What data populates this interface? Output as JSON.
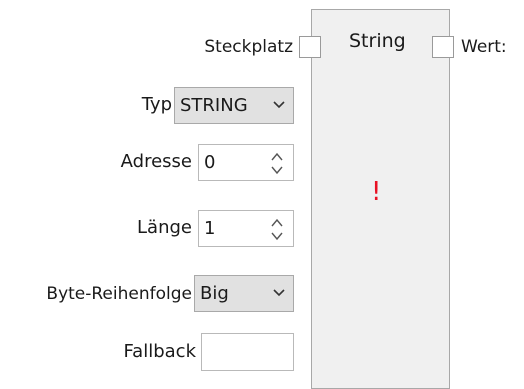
{
  "node": {
    "title": "String",
    "warning": "!",
    "input_port_label": "Steckplatz",
    "output_port_label": "Wert:"
  },
  "properties": {
    "type": {
      "label": "Typ",
      "value": "STRING"
    },
    "address": {
      "label": "Adresse",
      "value": "0"
    },
    "length": {
      "label": "Länge",
      "value": "1"
    },
    "byte_order": {
      "label": "Byte-Reihenfolge",
      "value": "Big"
    },
    "fallback": {
      "label": "Fallback",
      "value": ""
    }
  },
  "colors": {
    "warning": "#e81123",
    "node_background": "#f0f0f0",
    "select_background": "#e1e1e1"
  },
  "icons": [
    "chevron-down-icon",
    "spin-up-icon",
    "spin-down-icon"
  ]
}
